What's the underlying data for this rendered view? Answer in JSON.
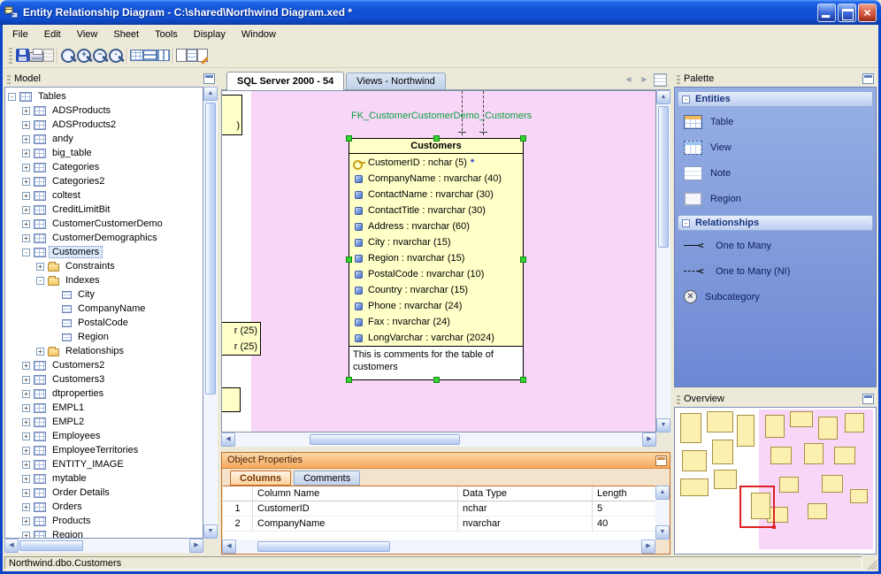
{
  "window": {
    "title": "Entity Relationship Diagram - C:\\shared\\Northwind Diagram.xed *",
    "status": "Northwind.dbo.Customers"
  },
  "menu_bar": {
    "items": [
      {
        "label": "File",
        "dn": "menu-file"
      },
      {
        "label": "Edit",
        "dn": "menu-edit"
      },
      {
        "label": "View",
        "dn": "menu-view"
      },
      {
        "label": "Sheet",
        "dn": "menu-sheet"
      },
      {
        "label": "Tools",
        "dn": "menu-tools"
      },
      {
        "label": "Display",
        "dn": "menu-display"
      },
      {
        "label": "Window",
        "dn": "menu-window"
      }
    ]
  },
  "toolbar": {
    "buttons": [
      {
        "cls": "ic-save",
        "dn": "save-button"
      },
      {
        "cls": "ic-print",
        "dn": "print-button"
      },
      {
        "cls": "ic-preview",
        "dn": "print-preview-button"
      },
      {
        "cls": "sep",
        "dn": "toolbar-separator"
      },
      {
        "cls": "ic-zoom",
        "dn": "zoom-normal-button"
      },
      {
        "cls": "ic-zoom plus",
        "dn": "zoom-in-button"
      },
      {
        "cls": "ic-zoom minus",
        "dn": "zoom-out-button"
      },
      {
        "cls": "ic-zoom area",
        "dn": "zoom-area-button"
      },
      {
        "cls": "sep",
        "dn": "toolbar-separator"
      },
      {
        "cls": "ic-grid",
        "dn": "show-grid-button"
      },
      {
        "cls": "ic-rows",
        "dn": "align-rows-button"
      },
      {
        "cls": "ic-cols",
        "dn": "align-columns-button"
      },
      {
        "cls": "sep",
        "dn": "toolbar-separator"
      },
      {
        "cls": "ic-page",
        "dn": "new-sheet-button"
      },
      {
        "cls": "ic-page grid",
        "dn": "sheet-grid-button"
      },
      {
        "cls": "ic-page edit",
        "dn": "sheet-edit-button"
      }
    ]
  },
  "model_panel": {
    "title": "Model",
    "items": [
      {
        "label": "Tables",
        "row": "d0",
        "icon": "i-table",
        "exp": "-"
      },
      {
        "label": "ADSProducts",
        "row": "d1",
        "icon": "i-table",
        "exp": "+"
      },
      {
        "label": "ADSProducts2",
        "row": "d1",
        "icon": "i-table",
        "exp": "+"
      },
      {
        "label": "andy",
        "row": "d1",
        "icon": "i-table",
        "exp": "+"
      },
      {
        "label": "big_table",
        "row": "d1",
        "icon": "i-table",
        "exp": "+"
      },
      {
        "label": "Categories",
        "row": "d1",
        "icon": "i-table",
        "exp": "+"
      },
      {
        "label": "Categories2",
        "row": "d1",
        "icon": "i-table",
        "exp": "+"
      },
      {
        "label": "coltest",
        "row": "d1",
        "icon": "i-table",
        "exp": "+"
      },
      {
        "label": "CreditLimitBit",
        "row": "d1",
        "icon": "i-table",
        "exp": "+"
      },
      {
        "label": "CustomerCustomerDemo",
        "row": "d1",
        "icon": "i-table",
        "exp": "+"
      },
      {
        "label": "CustomerDemographics",
        "row": "d1",
        "icon": "i-table",
        "exp": "+"
      },
      {
        "label": "Customers",
        "row": "d1",
        "icon": "i-table",
        "exp": "-",
        "sel": "selected"
      },
      {
        "label": "Constraints",
        "row": "d2",
        "icon": "i-folder",
        "exp": "+"
      },
      {
        "label": "Indexes",
        "row": "d2",
        "icon": "i-folder",
        "exp": "-"
      },
      {
        "label": "City",
        "row": "d3",
        "icon": "i-index",
        "exp": ""
      },
      {
        "label": "CompanyName",
        "row": "d3",
        "icon": "i-index",
        "exp": ""
      },
      {
        "label": "PostalCode",
        "row": "d3",
        "icon": "i-index",
        "exp": ""
      },
      {
        "label": "Region",
        "row": "d3",
        "icon": "i-index",
        "exp": ""
      },
      {
        "label": "Relationships",
        "row": "d2",
        "icon": "i-folder",
        "exp": "+"
      },
      {
        "label": "Customers2",
        "row": "d1",
        "icon": "i-table",
        "exp": "+"
      },
      {
        "label": "Customers3",
        "row": "d1",
        "icon": "i-table",
        "exp": "+"
      },
      {
        "label": "dtproperties",
        "row": "d1",
        "icon": "i-table",
        "exp": "+"
      },
      {
        "label": "EMPL1",
        "row": "d1",
        "icon": "i-table",
        "exp": "+"
      },
      {
        "label": "EMPL2",
        "row": "d1",
        "icon": "i-table",
        "exp": "+"
      },
      {
        "label": "Employees",
        "row": "d1",
        "icon": "i-table",
        "exp": "+"
      },
      {
        "label": "EmployeeTerritories",
        "row": "d1",
        "icon": "i-table",
        "exp": "+"
      },
      {
        "label": "ENTITY_IMAGE",
        "row": "d1",
        "icon": "i-table",
        "exp": "+"
      },
      {
        "label": "mytable",
        "row": "d1",
        "icon": "i-table",
        "exp": "+"
      },
      {
        "label": "Order Details",
        "row": "d1",
        "icon": "i-table",
        "exp": "+"
      },
      {
        "label": "Orders",
        "row": "d1",
        "icon": "i-table",
        "exp": "+"
      },
      {
        "label": "Products",
        "row": "d1",
        "icon": "i-table",
        "exp": "+"
      },
      {
        "label": "Region",
        "row": "d1",
        "icon": "i-table",
        "exp": "+"
      }
    ]
  },
  "canvas": {
    "tabs": [
      {
        "label": "SQL Server 2000 - 54",
        "cls": "active",
        "dn": "tab-sql-server-2000-54"
      },
      {
        "label": "Views - Northwind",
        "cls": "",
        "dn": "tab-views-northwind"
      }
    ],
    "fk_label": "FK_CustomerCustomerDemo_Customers",
    "clipped": {
      "top_text": ")",
      "rows": [
        "r (25)",
        "r (25)"
      ]
    },
    "entity": {
      "title": "Customers",
      "fields": [
        {
          "text": "CustomerID : nchar (5)",
          "icon": "fi-key",
          "star": "*"
        },
        {
          "text": "CompanyName : nvarchar (40)",
          "icon": "fi-col",
          "star": ""
        },
        {
          "text": "ContactName : nvarchar (30)",
          "icon": "fi-col",
          "star": ""
        },
        {
          "text": "ContactTitle : nvarchar (30)",
          "icon": "fi-col",
          "star": ""
        },
        {
          "text": "Address : nvarchar (60)",
          "icon": "fi-col",
          "star": ""
        },
        {
          "text": "City : nvarchar (15)",
          "icon": "fi-col",
          "star": ""
        },
        {
          "text": "Region : nvarchar (15)",
          "icon": "fi-col",
          "star": ""
        },
        {
          "text": "PostalCode : nvarchar (10)",
          "icon": "fi-col",
          "star": ""
        },
        {
          "text": "Country : nvarchar (15)",
          "icon": "fi-col",
          "star": ""
        },
        {
          "text": "Phone : nvarchar (24)",
          "icon": "fi-col",
          "star": ""
        },
        {
          "text": "Fax : nvarchar (24)",
          "icon": "fi-col",
          "star": ""
        },
        {
          "text": "LongVarchar : varchar (2024)",
          "icon": "fi-col",
          "star": ""
        }
      ],
      "comment": "This is comments for the table of customers"
    }
  },
  "object_properties": {
    "title": "Object Properties",
    "tabs": [
      {
        "label": "Columns",
        "cls": "active",
        "dn": "tab-columns"
      },
      {
        "label": "Comments",
        "cls": "",
        "dn": "tab-comments"
      }
    ],
    "grid": {
      "headers": [
        "Column Name",
        "Data Type",
        "Length"
      ],
      "rows": [
        {
          "num": "1",
          "name": "CustomerID",
          "type": "nchar",
          "length": "5"
        },
        {
          "num": "2",
          "name": "CompanyName",
          "type": "nvarchar",
          "length": "40"
        }
      ]
    }
  },
  "palette": {
    "title": "Palette",
    "sections": [
      {
        "label": "Entities",
        "items": [
          {
            "label": "Table",
            "icls": "pi-table",
            "dn": "palette-item-table"
          },
          {
            "label": "View",
            "icls": "pi-view",
            "dn": "palette-item-view"
          },
          {
            "label": "Note",
            "icls": "pi-note",
            "dn": "palette-item-note"
          },
          {
            "label": "Region",
            "icls": "pi-region",
            "dn": "palette-item-region"
          }
        ]
      },
      {
        "label": "Relationships",
        "items": [
          {
            "label": "One to Many",
            "icls": "pi-rel",
            "dn": "palette-item-one-to-many"
          },
          {
            "label": "One to Many (NI)",
            "icls": "pi-rel ni",
            "dn": "palette-item-one-to-many-ni"
          },
          {
            "label": "Subcategory",
            "icls": "pi-sub",
            "dn": "palette-item-subcategory"
          }
        ]
      }
    ]
  },
  "overview_panel": {
    "title": "Overview"
  }
}
